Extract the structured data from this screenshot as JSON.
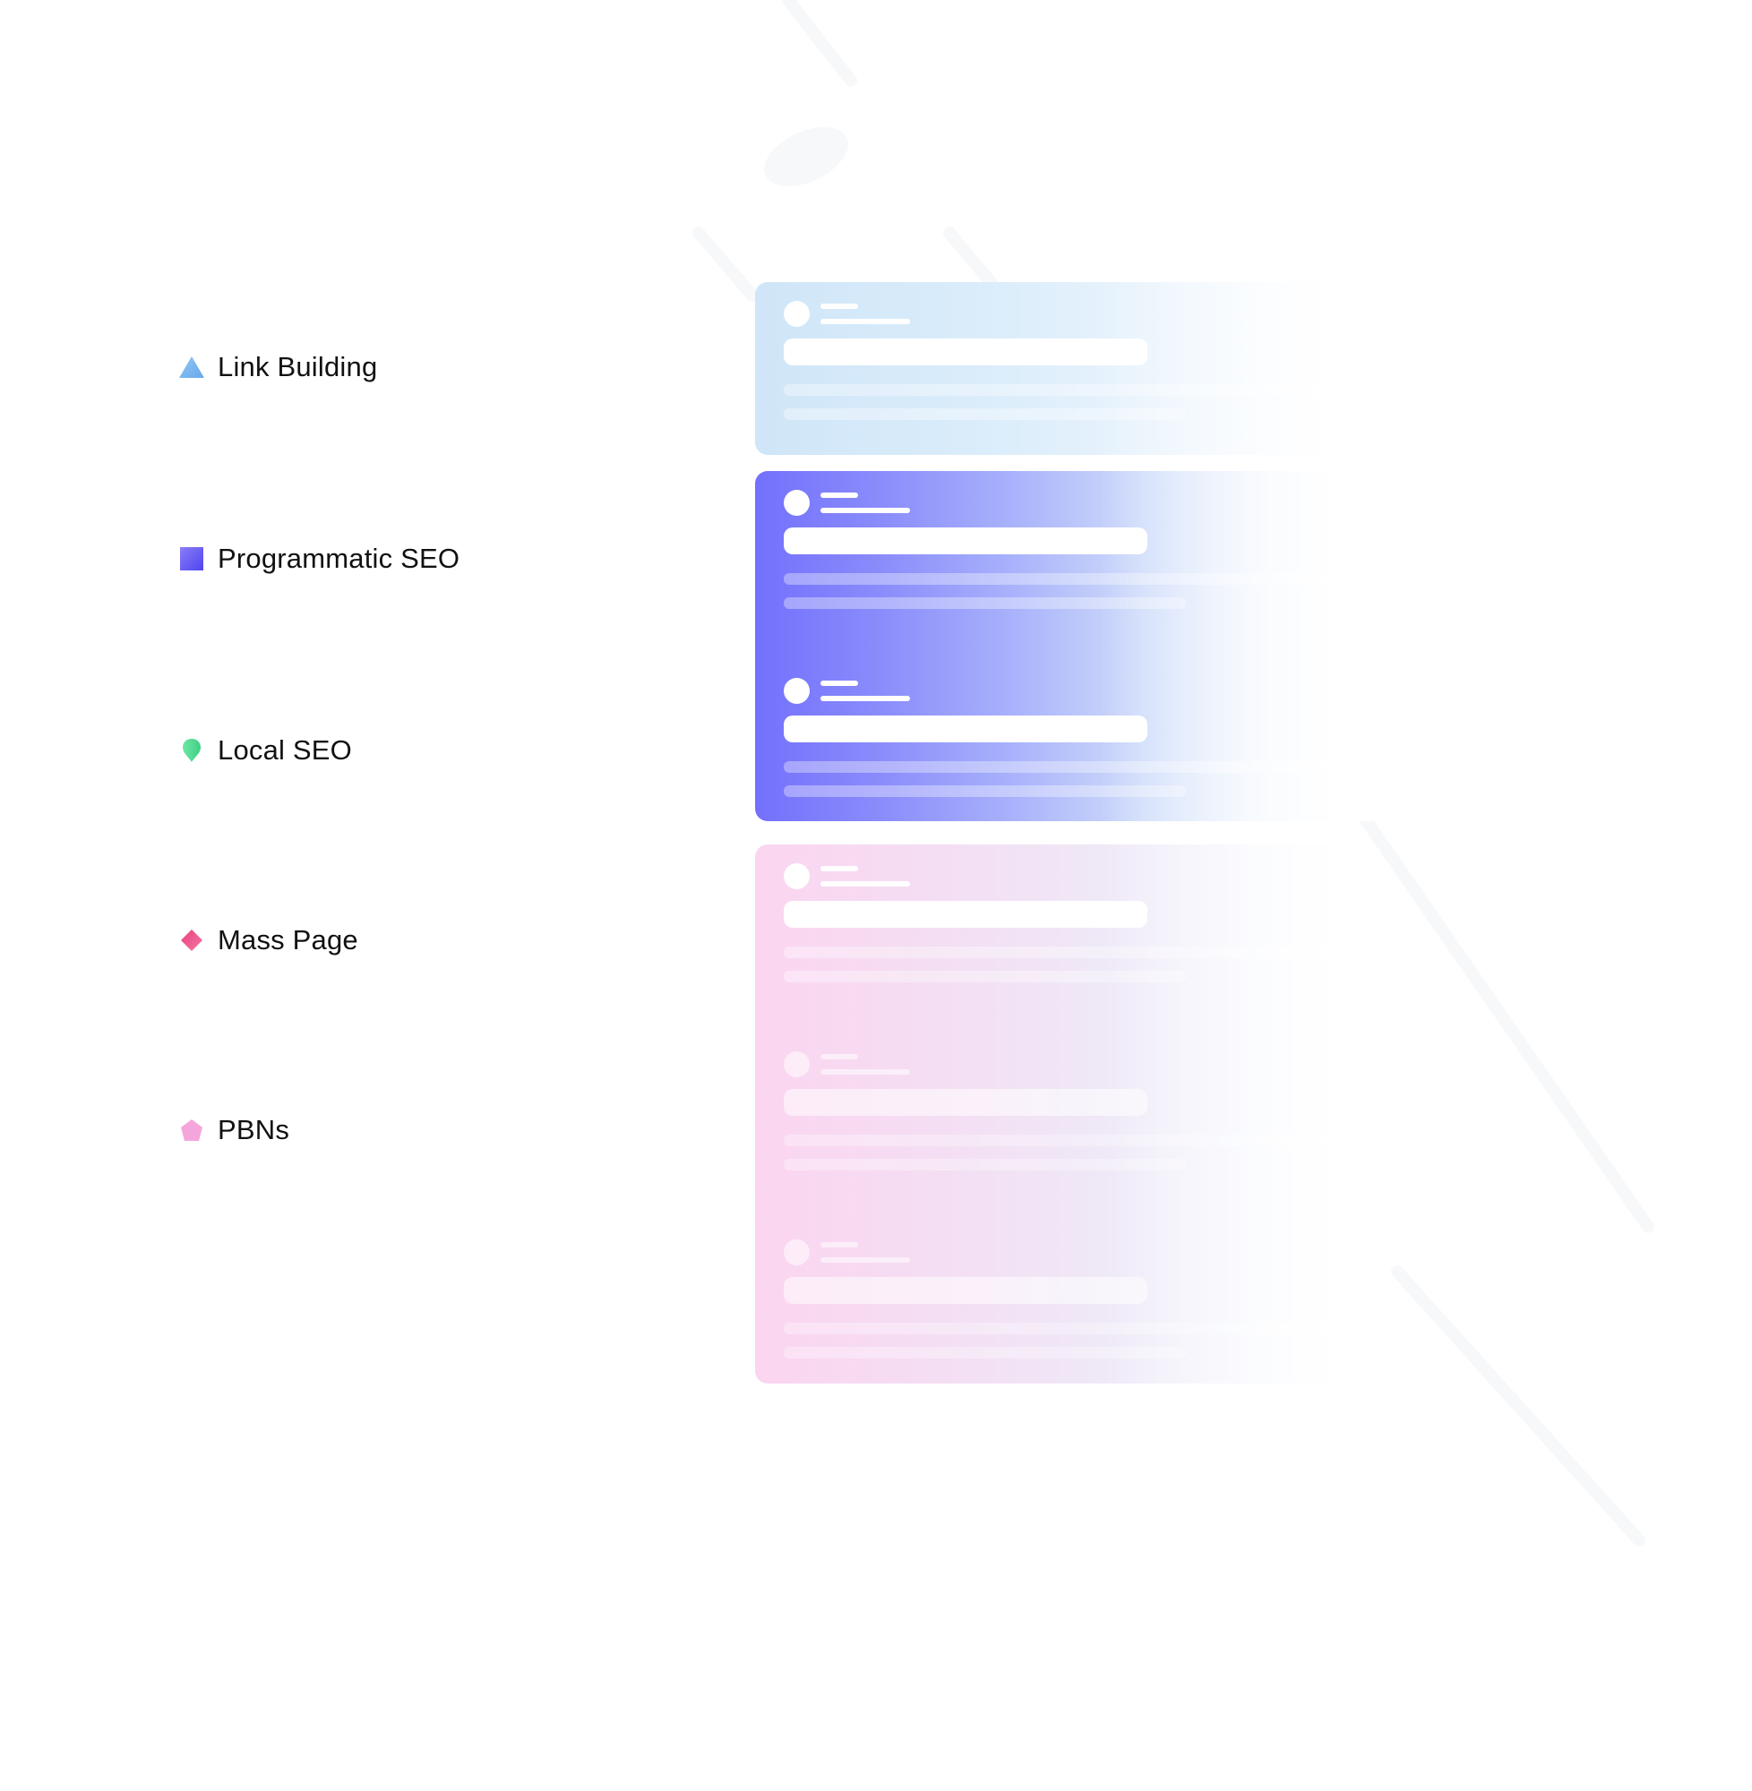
{
  "categories": [
    {
      "id": "link-building",
      "label": "Link Building",
      "icon": "triangle-icon",
      "color": "#7ab8ee"
    },
    {
      "id": "programmatic-seo",
      "label": "Programmatic SEO",
      "icon": "square-icon",
      "color": "#6a5cf5"
    },
    {
      "id": "local-seo",
      "label": "Local SEO",
      "icon": "map-pin-icon",
      "color": "#4fdc8e"
    },
    {
      "id": "mass-page",
      "label": "Mass Page",
      "icon": "diamond-icon",
      "color": "#ec4f86"
    },
    {
      "id": "pbns",
      "label": "PBNs",
      "icon": "pentagon-icon",
      "color": "#f4a6dc"
    }
  ],
  "cards": [
    {
      "id": "link-building-card",
      "color": "#cfe6f8",
      "placeholder_items": 1
    },
    {
      "id": "programmatic-seo-card",
      "color": "#7370fc",
      "placeholder_items": 2
    },
    {
      "id": "pbns-card",
      "color": "#fbd5f0",
      "placeholder_items": 3
    }
  ]
}
